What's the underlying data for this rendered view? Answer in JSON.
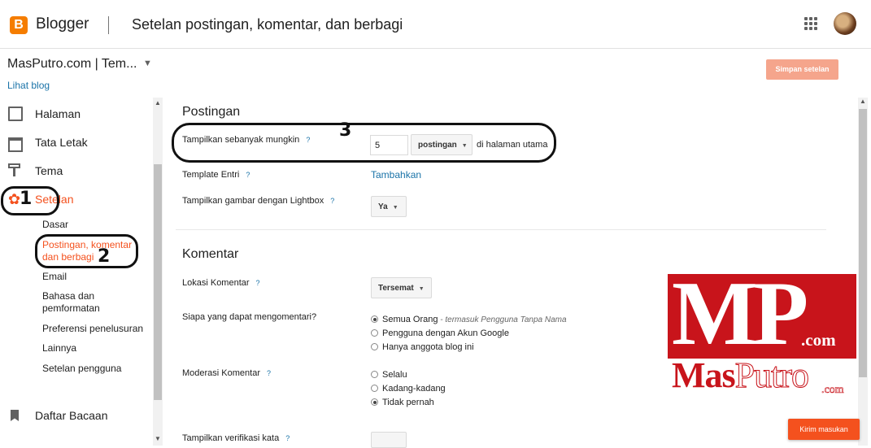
{
  "header": {
    "logo_letter": "B",
    "app_name": "Blogger",
    "page_title": "Setelan postingan, komentar, dan berbagi"
  },
  "blog": {
    "name": "MasPutro.com | Tem...",
    "view_link": "Lihat blog"
  },
  "toolbar": {
    "save_label": "Simpan setelan"
  },
  "sidebar": {
    "items": [
      {
        "label": "Halaman",
        "icon": "page-icon"
      },
      {
        "label": "Tata Letak",
        "icon": "layout-icon"
      },
      {
        "label": "Tema",
        "icon": "paint-roller-icon"
      },
      {
        "label": "Setelan",
        "icon": "gear-icon",
        "active": true
      },
      {
        "label": "Daftar Bacaan",
        "icon": "bookmark-icon"
      }
    ],
    "subitems": [
      "Dasar",
      "Postingan, komentar dan berbagi",
      "Email",
      "Bahasa dan pemformatan",
      "Preferensi penelusuran",
      "Lainnya",
      "Setelan pengguna"
    ]
  },
  "annotations": [
    "1",
    "2",
    "3"
  ],
  "postingan": {
    "title": "Postingan",
    "show_label": "Tampilkan sebanyak mungkin",
    "help": "?",
    "count_value": "5",
    "unit_select": "postingan",
    "suffix": "di halaman utama",
    "template_label": "Template Entri",
    "template_link": "Tambahkan",
    "lightbox_label": "Tampilkan gambar dengan Lightbox",
    "lightbox_value": "Ya"
  },
  "komentar": {
    "title": "Komentar",
    "location_label": "Lokasi Komentar",
    "location_value": "Tersemat",
    "who_label": "Siapa yang dapat mengomentari?",
    "who_options": [
      "Semua Orang",
      "Pengguna dengan Akun Google",
      "Hanya anggota blog ini"
    ],
    "who_hint": " - termasuk Pengguna Tanpa Nama",
    "who_selected": 0,
    "moderation_label": "Moderasi Komentar",
    "moderation_options": [
      "Selalu",
      "Kadang-kadang",
      "Tidak pernah"
    ],
    "moderation_selected": 2,
    "verify_label": "Tampilkan verifikasi kata"
  },
  "watermark": {
    "mp": "MP",
    "com": ".com",
    "name_bold": "Mas",
    "name_outline": "Putro",
    "com2": ".com"
  },
  "feedback_label": "Kirim masukan",
  "colors": {
    "accent": "#f4511e",
    "link": "#1a73a8",
    "save_disabled": "#f5a58c",
    "watermark_red": "#c8141b"
  }
}
